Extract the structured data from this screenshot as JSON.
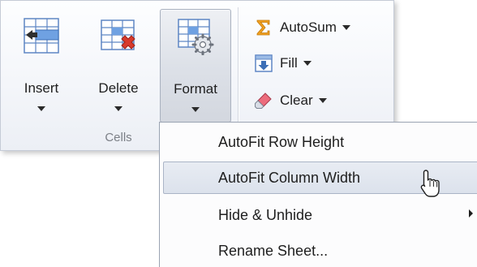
{
  "ribbon": {
    "cells_group": {
      "caption": "Cells",
      "buttons": [
        {
          "label": "Insert",
          "icon": "insert-cells-icon"
        },
        {
          "label": "Delete",
          "icon": "delete-cells-icon"
        },
        {
          "label": "Format",
          "icon": "format-cells-icon",
          "state": "pressed"
        }
      ]
    },
    "editing_group": {
      "buttons": [
        {
          "label": "AutoSum",
          "icon": "sigma-icon"
        },
        {
          "label": "Fill",
          "icon": "fill-down-icon"
        },
        {
          "label": "Clear",
          "icon": "eraser-icon"
        }
      ]
    }
  },
  "format_menu": {
    "items": [
      {
        "label": "AutoFit Row Height"
      },
      {
        "label": "AutoFit Column Width",
        "state": "hovered"
      },
      {
        "label": "Hide & Unhide",
        "has_submenu": true
      },
      {
        "label": "Rename Sheet..."
      }
    ]
  },
  "colors": {
    "accent_orange": "#f0a020",
    "delete_red": "#d83a2c",
    "hover_blue": "#dce2ec",
    "grid_blue": "#5e86c4"
  }
}
